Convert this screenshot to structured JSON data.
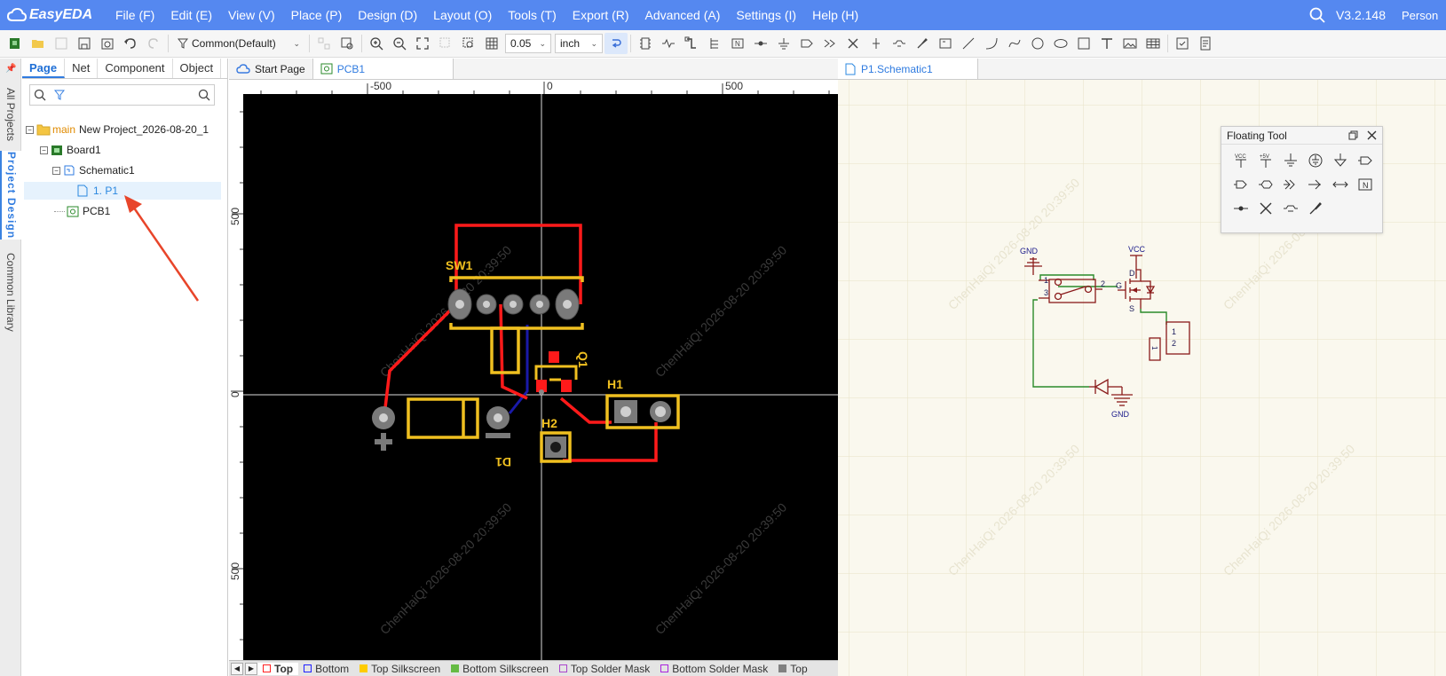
{
  "app": {
    "logo_text": "EasyEDA",
    "version": "V3.2.148",
    "user": "Person"
  },
  "menu": [
    "File (F)",
    "Edit (E)",
    "View (V)",
    "Place (P)",
    "Design (D)",
    "Layout (O)",
    "Tools (T)",
    "Export (R)",
    "Advanced (A)",
    "Settings (I)",
    "Help (H)"
  ],
  "toolbar": {
    "filter": "Common(Default)",
    "grid": "0.05",
    "unit": "inch"
  },
  "side_tabs": [
    "All Projects",
    "Project Design",
    "Common Library"
  ],
  "left_panel": {
    "tabs": [
      "Page",
      "Net",
      "Component",
      "Object"
    ],
    "search_placeholder": "",
    "tree": {
      "main_badge": "main",
      "project": "New Project_2026-08-20_1",
      "board": "Board1",
      "schematic": "Schematic1",
      "page": "1. P1",
      "pcb": "PCB1"
    }
  },
  "pcb_tabs": [
    "Start Page",
    "PCB1"
  ],
  "schematic_tabs": [
    "P1.Schematic1"
  ],
  "ruler": {
    "top": [
      "-500",
      "0",
      "500"
    ],
    "left": [
      "500",
      "0",
      "500"
    ]
  },
  "pcb": {
    "designators": [
      "SW1",
      "Q1",
      "H1",
      "H2",
      "D1"
    ],
    "watermark": "ChenHaiQi 2026-08-20 20:39:50"
  },
  "layers": [
    {
      "name": "Top",
      "color": "#ff2020"
    },
    {
      "name": "Bottom",
      "color": "#2020ff"
    },
    {
      "name": "Top Silkscreen",
      "color": "#ffcc00"
    },
    {
      "name": "Bottom Silkscreen",
      "color": "#66bb44"
    },
    {
      "name": "Top Solder Mask",
      "color": "#aa44cc"
    },
    {
      "name": "Bottom Solder Mask",
      "color": "#aa22dd"
    },
    {
      "name": "Top",
      "color": "#808080"
    }
  ],
  "floating_tool": {
    "title": "Floating Tool",
    "icons": [
      "vcc-icon",
      "plus5v-icon",
      "ground-icon",
      "earth-icon",
      "signal-ground-icon",
      "net-port-out-icon",
      "net-port-in-icon",
      "net-port-bidir-icon",
      "net-flag-icon",
      "bus-entry-icon",
      "ac-icon",
      "netlabel-icon",
      "junction-icon",
      "no-connect-icon",
      "probe-icon",
      "wire-icon"
    ]
  },
  "schematic": {
    "labels": [
      "GND",
      "VCC",
      "GND",
      "D",
      "G",
      "S",
      "1",
      "2",
      "3",
      "1",
      "2",
      "1"
    ]
  }
}
